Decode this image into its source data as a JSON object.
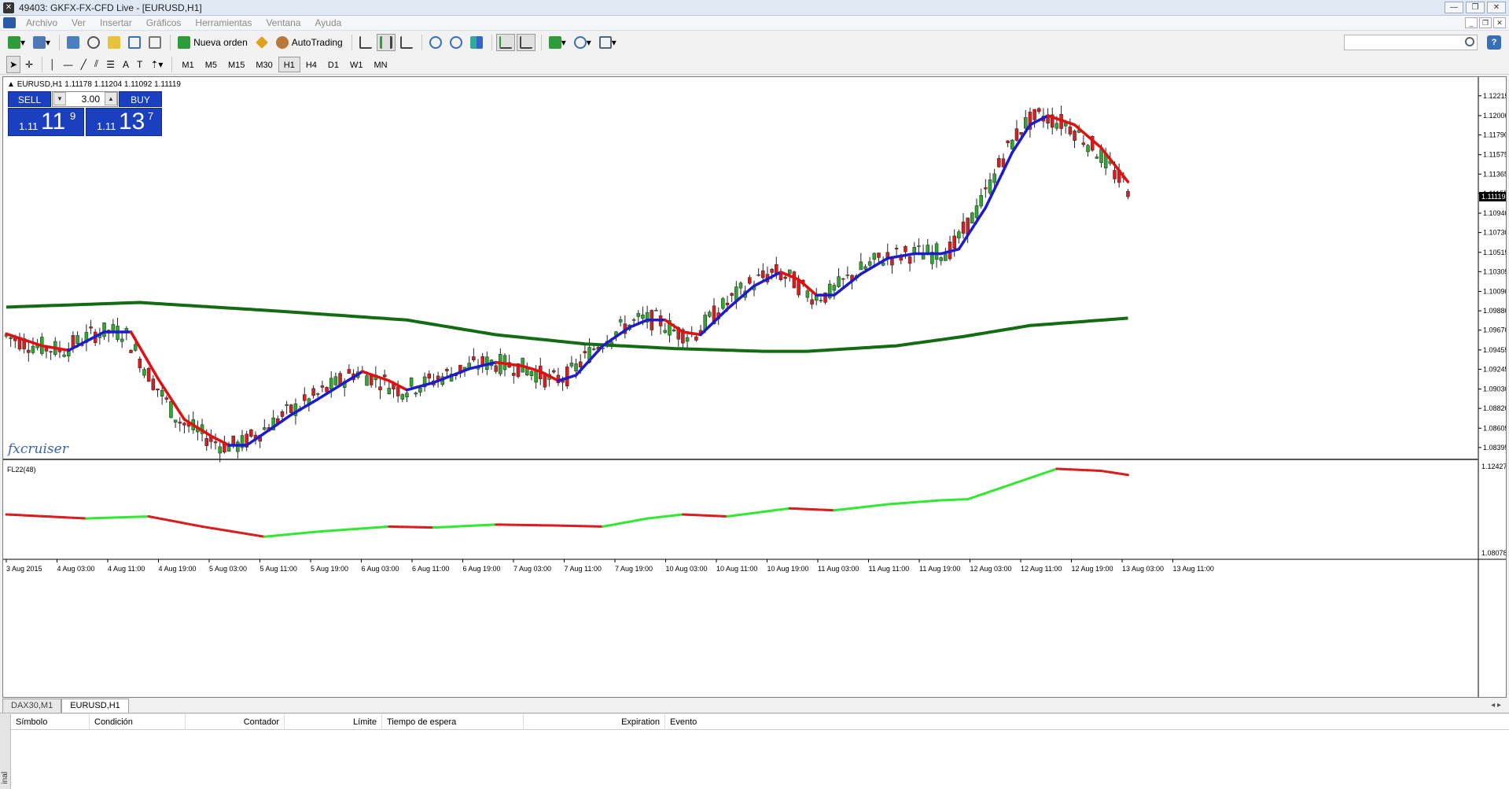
{
  "window": {
    "title": "49403: GKFX-FX-CFD Live - [EURUSD,H1]"
  },
  "menu": [
    "Archivo",
    "Ver",
    "Insertar",
    "Gráficos",
    "Herramientas",
    "Ventana",
    "Ayuda"
  ],
  "toolbar": {
    "new_order": "Nueva orden",
    "autotrading": "AutoTrading"
  },
  "timeframes": [
    "M1",
    "M5",
    "M15",
    "M30",
    "H1",
    "H4",
    "D1",
    "W1",
    "MN"
  ],
  "active_timeframe": "H1",
  "chart": {
    "symbol_info": "EURUSD,H1  1.11178 1.11204 1.11092 1.11119",
    "watermark": "fxcruiser",
    "indicator_label": "FL22(48)",
    "current_price": "1.11119",
    "price_ticks": [
      "1.12215",
      "1.12000",
      "1.11790",
      "1.11575",
      "1.11365",
      "1.11155",
      "1.10940",
      "1.10730",
      "1.10515",
      "1.10305",
      "1.10090",
      "1.09880",
      "1.09670",
      "1.09455",
      "1.09245",
      "1.09030",
      "1.08820",
      "1.08605",
      "1.08395"
    ],
    "ind_ticks": [
      "1.124275",
      "1.080787"
    ],
    "time_ticks": [
      "3 Aug 2015",
      "4 Aug 03:00",
      "4 Aug 11:00",
      "4 Aug 19:00",
      "5 Aug 03:00",
      "5 Aug 11:00",
      "5 Aug 19:00",
      "6 Aug 03:00",
      "6 Aug 11:00",
      "6 Aug 19:00",
      "7 Aug 03:00",
      "7 Aug 11:00",
      "7 Aug 19:00",
      "10 Aug 03:00",
      "10 Aug 11:00",
      "10 Aug 19:00",
      "11 Aug 03:00",
      "11 Aug 11:00",
      "11 Aug 19:00",
      "12 Aug 03:00",
      "12 Aug 11:00",
      "12 Aug 19:00",
      "13 Aug 03:00",
      "13 Aug 11:00"
    ],
    "colors": {
      "up": "#2ea82e",
      "down": "#d81e1e",
      "ma_up": "#1c1ccc",
      "ma_down": "#e01010",
      "slow_ma": "#136b13",
      "ind_up": "#33e833",
      "ind_down": "#d81e1e"
    }
  },
  "chart_data": {
    "type": "candlestick",
    "symbol": "EURUSD",
    "timeframe": "H1",
    "open": 1.11178,
    "high": 1.11204,
    "low": 1.11092,
    "close": 1.11119,
    "fast_ma": [
      [
        0,
        1.0963
      ],
      [
        8,
        1.095
      ],
      [
        14,
        1.0945
      ],
      [
        22,
        1.0965
      ],
      [
        28,
        1.0965
      ],
      [
        34,
        1.0915
      ],
      [
        40,
        1.087
      ],
      [
        46,
        1.0852
      ],
      [
        50,
        1.0842
      ],
      [
        54,
        1.0842
      ],
      [
        58,
        1.0855
      ],
      [
        64,
        1.0875
      ],
      [
        70,
        1.0892
      ],
      [
        76,
        1.091
      ],
      [
        80,
        1.0922
      ],
      [
        86,
        1.0912
      ],
      [
        90,
        1.0902
      ],
      [
        96,
        1.091
      ],
      [
        104,
        1.0925
      ],
      [
        110,
        1.0932
      ],
      [
        116,
        1.0928
      ],
      [
        120,
        1.0922
      ],
      [
        124,
        1.0912
      ],
      [
        128,
        1.0918
      ],
      [
        134,
        1.095
      ],
      [
        140,
        1.097
      ],
      [
        144,
        1.0978
      ],
      [
        148,
        1.0978
      ],
      [
        152,
        1.0965
      ],
      [
        156,
        1.0962
      ],
      [
        162,
        1.099
      ],
      [
        168,
        1.1015
      ],
      [
        174,
        1.103
      ],
      [
        178,
        1.1022
      ],
      [
        182,
        1.1005
      ],
      [
        186,
        1.1005
      ],
      [
        192,
        1.1028
      ],
      [
        198,
        1.1045
      ],
      [
        204,
        1.105
      ],
      [
        210,
        1.105
      ],
      [
        214,
        1.1055
      ],
      [
        220,
        1.11
      ],
      [
        226,
        1.116
      ],
      [
        230,
        1.119
      ],
      [
        234,
        1.12
      ],
      [
        240,
        1.119
      ],
      [
        246,
        1.1165
      ],
      [
        252,
        1.1128
      ]
    ],
    "slow_ma": [
      [
        0,
        1.0992
      ],
      [
        30,
        1.0997
      ],
      [
        60,
        1.0988
      ],
      [
        90,
        1.0978
      ],
      [
        110,
        1.0962
      ],
      [
        130,
        1.0952
      ],
      [
        150,
        1.0947
      ],
      [
        170,
        1.0944
      ],
      [
        180,
        1.0944
      ],
      [
        200,
        1.095
      ],
      [
        215,
        1.096
      ],
      [
        230,
        1.0972
      ],
      [
        252,
        1.098
      ]
    ],
    "indicator": [
      [
        0,
        1.101
      ],
      [
        18,
        1.099
      ],
      [
        32,
        1.1
      ],
      [
        44,
        1.095
      ],
      [
        58,
        1.09
      ],
      [
        70,
        1.0925
      ],
      [
        86,
        1.095
      ],
      [
        96,
        1.0945
      ],
      [
        110,
        1.096
      ],
      [
        124,
        1.0955
      ],
      [
        134,
        1.095
      ],
      [
        144,
        1.099
      ],
      [
        152,
        1.101
      ],
      [
        162,
        1.1
      ],
      [
        176,
        1.104
      ],
      [
        186,
        1.103
      ],
      [
        198,
        1.106
      ],
      [
        210,
        1.108
      ],
      [
        216,
        1.1085
      ],
      [
        226,
        1.116
      ],
      [
        236,
        1.1235
      ],
      [
        246,
        1.1225
      ],
      [
        252,
        1.1205
      ]
    ],
    "ylim": [
      1.083,
      1.1235
    ],
    "ind_ylim": [
      1.080787,
      1.124275
    ]
  },
  "terminal": {
    "tabs": [
      "DAX30,M1",
      "EURUSD,H1"
    ],
    "active_tab": "EURUSD,H1",
    "columns": [
      "Símbolo",
      "Condición",
      "Contador",
      "Límite",
      "Tiempo de espera",
      "Expiration",
      "Evento"
    ],
    "side_label": "inal"
  },
  "oneclick": {
    "sell": "SELL",
    "buy": "BUY",
    "lot": "3.00",
    "sell_prefix": "1.11",
    "sell_big": "11",
    "sell_sup": "9",
    "buy_prefix": "1.11",
    "buy_big": "13",
    "buy_sup": "7"
  }
}
